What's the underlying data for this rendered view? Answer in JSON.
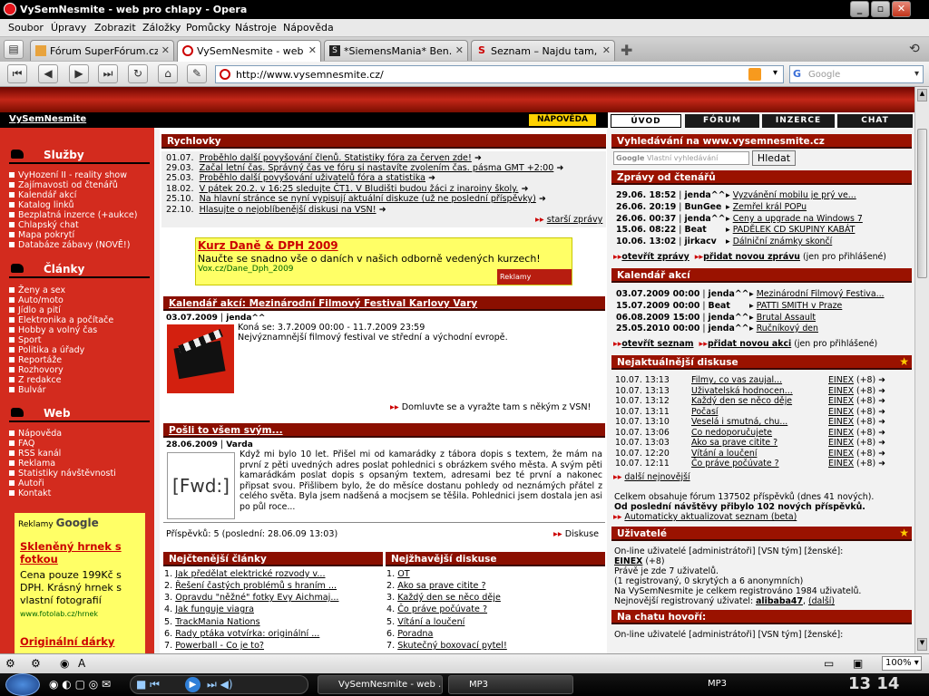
{
  "window": {
    "title": "VySemNesmite - web pro chlapy - Opera"
  },
  "menu": [
    "Soubor",
    "Úpravy",
    "Zobrazit",
    "Záložky",
    "Pomůcky",
    "Nástroje",
    "Nápověda"
  ],
  "tabs": [
    {
      "label": "Fórum SuperFórum.cz - ..."
    },
    {
      "label": "VySemNesmite - web pro..."
    },
    {
      "label": "*SiemensMania* Ben..."
    },
    {
      "label": "Seznam – Najdu tam, co ..."
    }
  ],
  "address": {
    "url": "http://www.vysemnesmite.cz/"
  },
  "search": {
    "placeholder": "Google"
  },
  "site": {
    "name": "VySemNesmite",
    "help": "NÁPOVĚDA",
    "right_tabs": [
      "ÚVOD",
      "FÓRUM",
      "INZERCE",
      "CHAT"
    ]
  },
  "left": {
    "sections": [
      {
        "title": "Služby",
        "items": [
          "VyHození II - reality show",
          "Zajímavosti od čtenářů",
          "Kalendář akcí",
          "Katalog linků",
          "Bezplatná inzerce (+aukce)",
          "Chlapský chat",
          "Mapa pokrytí",
          "Databáze zábavy (NOVĚ!)"
        ]
      },
      {
        "title": "Články",
        "items": [
          "Ženy a sex",
          "Auto/moto",
          "Jídlo a pití",
          "Elektronika a počítače",
          "Hobby a volný čas",
          "Sport",
          "Politika a úřady",
          "Reportáže",
          "Rozhovory",
          "Z redakce",
          "Bulvár"
        ]
      },
      {
        "title": "Web",
        "items": [
          "Nápověda",
          "FAQ",
          "RSS kanál",
          "Reklama",
          "Statistiky návštěvnosti",
          "Autoři",
          "Kontakt"
        ]
      }
    ],
    "ads": {
      "label": "Reklamy",
      "brand": "Google",
      "title": "Skleněný hrnek s fotkou",
      "text": "Cena pouze 199Kč s DPH. Krásný hrnek s vlastní fotografií",
      "url": "www.fotolab.cz/hrnek",
      "title2": "Originální dárky"
    }
  },
  "rychlovky": {
    "title": "Rychlovky",
    "items": [
      {
        "date": "01.07.",
        "text": "Proběhlo další povyšování členů. Statistiky fóra za červen zde!"
      },
      {
        "date": "29.03.",
        "text": "Začal letní čas. Správný čas ve fóru si nastavíte zvolením čas. pásma GMT +2:00"
      },
      {
        "date": "25.03.",
        "text": "Proběhlo další povyšování uživatelů fóra a statistika"
      },
      {
        "date": "18.02.",
        "text": "V pátek 20.2. v 16:25 sledujte ČT1. V Bludišti budou žáci z inaroiny školy."
      },
      {
        "date": "25.10.",
        "text": "Na hlavní stránce se nyní vypisují aktuální diskuze (už ne poslední příspěvky)"
      },
      {
        "date": "22.10.",
        "text": "Hlasujte o nejoblíbenější diskusi na VSN!"
      }
    ],
    "more": "starší zprávy"
  },
  "ad_center": {
    "title": "Kurz Daně & DPH 2009",
    "text": "Naučte se snadno vše o daních v našich odborně vedených kurzech!",
    "url": "Vox.cz/Dane_Dph_2009",
    "label": "Reklamy",
    "brand": "Google"
  },
  "article1": {
    "title": "Kalendář akcí: Mezinárodní Filmový Festival Karlovy Vary",
    "date": "03.07.2009",
    "author": "jenda^^",
    "line1": "Koná se: 3.7.2009 00:00 - 11.7.2009 23:59",
    "line2": "Nejvýznamnější filmový festival ve střední a východní evropě.",
    "footer": "Domluvte se a vyražte tam s někým z VSN!"
  },
  "article2": {
    "title": "Pošli to všem svým...",
    "date": "28.06.2009",
    "author": "Varda",
    "icon_text": "[Fwd:]",
    "body": "Když mi bylo 10 let. Přišel mi od kamarádky z tábora dopis s textem, že mám na první z pěti uvedných adres poslat pohlednici s obrázkem svého města. A svým pěti kamarádkám poslat dopis s opsaným textem, adresami bez té první a nakonec připsat svou. Přišlibem bylo, že do měsíce dostanu pohledy od neznámých přátel z celého světa. Byla jsem nadšená a mocjsem se těšila. Pohlednici jsem dostala jen asi po půl roce...",
    "posts": "Příspěvků: 5 (poslední: 28.06.09 13:03)",
    "discussion": "Diskuse"
  },
  "bottom_lists": {
    "read_title": "Nejčtenější články",
    "read": [
      "Jak předělat elektrické rozvody v...",
      "Řešení častých problémů s hraním ...",
      "Opravdu \"něžné\" fotky Evy Aichmaj...",
      "Jak funguje viagra",
      "TrackMania Nations",
      "Rady ptáka votvírka: originální ...",
      "Powerball - Co je to?"
    ],
    "hot_title": "Nejžhavější diskuse",
    "hot": [
      "OT",
      "Ako sa prave citite ?",
      "Každý den se něco děje",
      "Čo práve počúvate ?",
      "Vítání a loučení",
      "Poradna",
      "Skutečný boxovací pytel!"
    ]
  },
  "right": {
    "search_title": "Vyhledávání na www.vysemnesmite.cz",
    "search_placeholder": "Vlastní vyhledávání",
    "search_button": "Hledat",
    "news_title": "Zprávy od čtenářů",
    "news": [
      {
        "dt": "29.06. 18:52",
        "user": "jenda^^",
        "text": "Vyzvánění mobilu je prý ve..."
      },
      {
        "dt": "26.06. 20:19",
        "user": "BunGee",
        "text": "Zemřel král POPu"
      },
      {
        "dt": "26.06. 00:37",
        "user": "jenda^^",
        "text": "Ceny a upgrade na Windows 7"
      },
      {
        "dt": "15.06. 08:22",
        "user": "Beat",
        "text": "PADĚLEK CD SKUPINY KABÁT"
      },
      {
        "dt": "10.06. 13:02",
        "user": "jirkacv",
        "text": "Dálniční známky skončí"
      }
    ],
    "news_open": "otevřít zprávy",
    "news_add": "přidat novou zprávu",
    "news_note": "(jen pro přihlášené)",
    "cal_title": "Kalendář akcí",
    "cal": [
      {
        "dt": "03.07.2009 00:00",
        "user": "jenda^^",
        "text": "Mezinárodní Filmový Festiva..."
      },
      {
        "dt": "15.07.2009 00:00",
        "user": "Beat",
        "text": "PATTI SMITH v Praze"
      },
      {
        "dt": "06.08.2009 15:00",
        "user": "jenda^^",
        "text": "Brutal Assault"
      },
      {
        "dt": "25.05.2010 00:00",
        "user": "jenda^^",
        "text": "Ručníkový den"
      }
    ],
    "cal_open": "otevřít seznam",
    "cal_add": "přidat novou akci",
    "cal_note": "(jen pro přihlášené)",
    "disc_title": "Nejaktuálnější diskuse",
    "disc": [
      {
        "dt": "10.07. 13:13",
        "text": "Filmy, co vas zaujal...",
        "user": "EINEX",
        "n": "(+8)"
      },
      {
        "dt": "10.07. 13:13",
        "text": "Uživatelská hodnocen...",
        "user": "EINEX",
        "n": "(+8)"
      },
      {
        "dt": "10.07. 13:12",
        "text": "Každý den se něco děje",
        "user": "EINEX",
        "n": "(+8)"
      },
      {
        "dt": "10.07. 13:11",
        "text": "Počasí",
        "user": "EINEX",
        "n": "(+8)"
      },
      {
        "dt": "10.07. 13:10",
        "text": "Veselá i smutná, chu...",
        "user": "EINEX",
        "n": "(+8)"
      },
      {
        "dt": "10.07. 13:06",
        "text": "Co nedoporučujete",
        "user": "EINEX",
        "n": "(+8)"
      },
      {
        "dt": "10.07. 13:03",
        "text": "Ako sa prave citite ?",
        "user": "EINEX",
        "n": "(+8)"
      },
      {
        "dt": "10.07. 12:20",
        "text": "Vítání a loučení",
        "user": "EINEX",
        "n": "(+8)"
      },
      {
        "dt": "10.07. 12:11",
        "text": "Čo práve počúvate ?",
        "user": "EINEX",
        "n": "(+8)"
      }
    ],
    "disc_more": "další nejnovější",
    "stats1": "Celkem obsahuje fórum 137502 příspěvků (dnes 41 nových).",
    "stats2": "Od poslední návštěvy přibylo 102 nových příspěvků.",
    "auto": "Automaticky aktualizovat seznam (beta)",
    "users_title": "Uživatelé",
    "online": "On-line uživatelé [administrátoři] [VSN tým] [ženské]:",
    "online_user": "EINEX",
    "online_n": "(+8)",
    "u1": "Právě je zde 7 uživatelů.",
    "u2": "(1 registrovaný, 0 skrytých a 6 anonymních)",
    "u3": "Na VySemNesmite je celkem registrováno 1984 uživatelů.",
    "u4a": "Nejnovější registrovaný uživatel:",
    "u4b": "alibaba47",
    "u4c": "(další)",
    "chat_title": "Na chatu hovoří:",
    "chat_online": "On-line uživatelé [administrátoři] [VSN tým] [ženské]:"
  },
  "status": {
    "zoom": "100%"
  },
  "taskbar": {
    "items": [
      "VySemNesmite - web ...",
      "MP3"
    ],
    "clock": "13 14",
    "lang": "MP3"
  }
}
